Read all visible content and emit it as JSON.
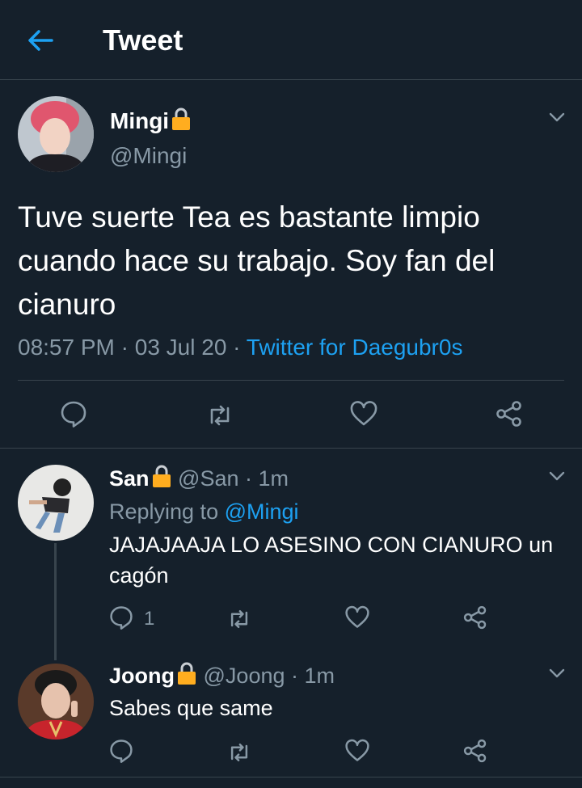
{
  "header": {
    "title": "Tweet"
  },
  "main_tweet": {
    "name": "Mingi",
    "handle": "@Mingi",
    "text": "Tuve suerte Tea es bastante limpio cuando hace su trabajo. Soy fan del cianuro",
    "time": "08:57 PM",
    "sep1": "·",
    "date": "03 Jul 20",
    "sep2": "·",
    "source": "Twitter for Daegubr0s"
  },
  "replies": [
    {
      "name": "San",
      "handle": "@San",
      "dot": "·",
      "time": "1m",
      "replying_prefix": "Replying to",
      "replying_to": "@Mingi",
      "text": "JAJAJAAJA LO ASESINO CON CIANURO un cagón",
      "reply_count": "1"
    },
    {
      "name": "Joong",
      "handle": "@Joong",
      "dot": "·",
      "time": "1m",
      "text": "Sabes que same"
    }
  ],
  "colors": {
    "background": "#15202b",
    "accent": "#1da1f2",
    "muted": "#8899a6",
    "divider": "#38444d",
    "lock": "#ffad1f"
  },
  "icons": [
    "back-arrow-icon",
    "lock-icon",
    "chevron-down-icon",
    "reply-icon",
    "retweet-icon",
    "like-icon",
    "share-icon"
  ]
}
